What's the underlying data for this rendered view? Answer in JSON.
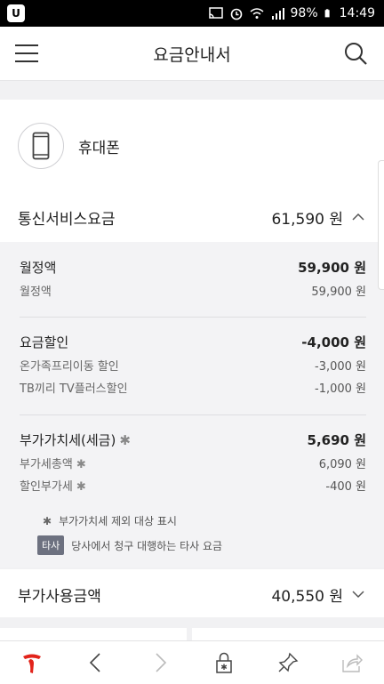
{
  "status_bar": {
    "battery": "98%",
    "time": "14:49",
    "app_badge": "U"
  },
  "header": {
    "title": "요금안내서"
  },
  "device": {
    "label": "휴대폰"
  },
  "telecom": {
    "name": "통신서비스요금",
    "amount": "61,590 원"
  },
  "groups": {
    "monthly": {
      "title": "월정액",
      "total": "59,900 원",
      "items": [
        {
          "label": "월정액",
          "value": "59,900 원"
        }
      ]
    },
    "discount": {
      "title": "요금할인",
      "total": "-4,000 원",
      "items": [
        {
          "label": "온가족프리이동 할인",
          "value": "-3,000 원"
        },
        {
          "label": "TB끼리 TV플러스할인",
          "value": "-1,000 원"
        }
      ]
    },
    "vat": {
      "title": "부가가치세(세금)",
      "total": "5,690 원",
      "items": [
        {
          "label": "부가세총액",
          "value": "6,090 원"
        },
        {
          "label": "할인부가세",
          "value": "-400 원"
        }
      ]
    }
  },
  "notes": {
    "vat_note": "부가가치세 제외 대상 표시",
    "badge": "타사",
    "other_note": "당사에서 청구 대행하는 타사 요금"
  },
  "additional": {
    "name": "부가사용금액",
    "amount": "40,550 원"
  },
  "colors": {
    "brand_red": "#e2231a",
    "badge_bg": "#6d7180"
  }
}
